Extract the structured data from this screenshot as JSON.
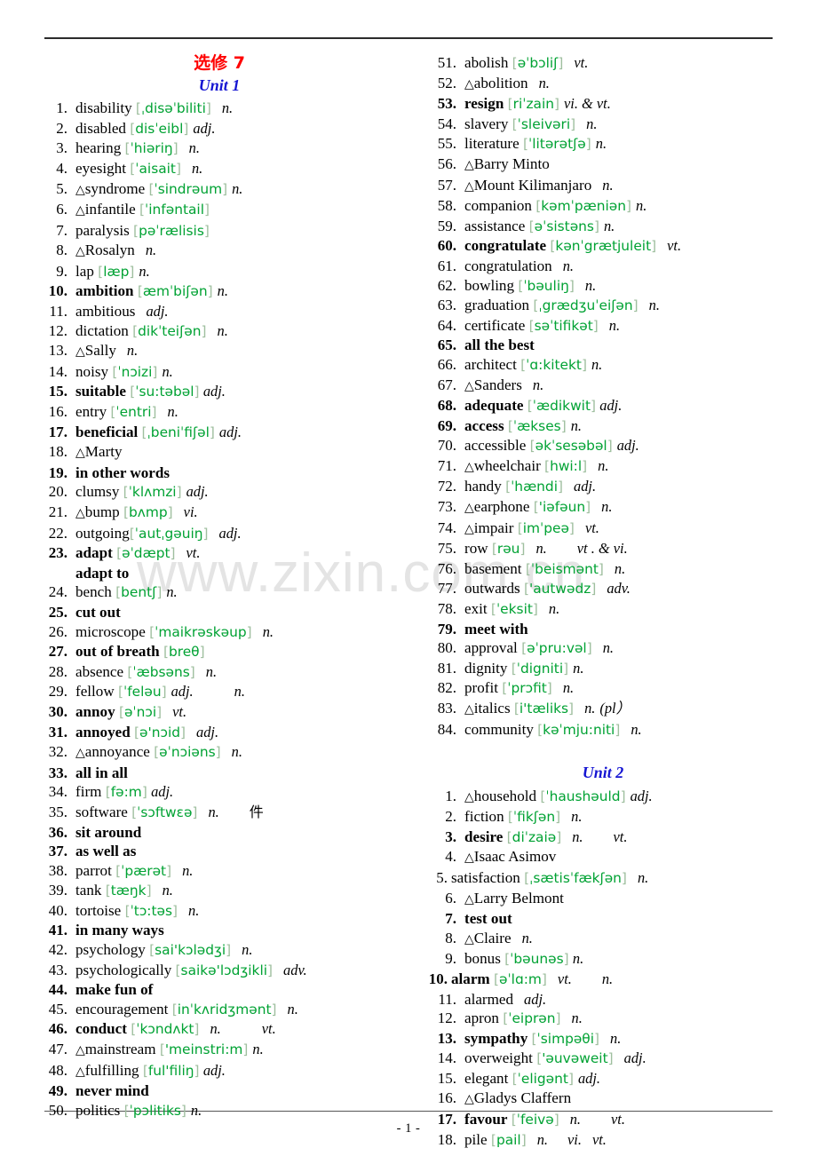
{
  "document": {
    "title_main": "选修 7",
    "watermark": "www.zixin.com.cn",
    "page_number": "- 1 -"
  },
  "left_column": {
    "unit_heading": "Unit 1",
    "entries": [
      {
        "n": "1.",
        "word": "disability",
        "ph": "[ˌdisəˈbiliti]",
        "pos": "n.",
        "bold": false,
        "tri": false,
        "gap": "sp2"
      },
      {
        "n": "2.",
        "word": "disabled",
        "ph": "[disˈeibl]",
        "pos": "adj.",
        "bold": false,
        "tri": false,
        "gap": "sp1"
      },
      {
        "n": "3.",
        "word": "hearing",
        "ph": "[ˈhiəriŋ]",
        "pos": "n.",
        "bold": false,
        "tri": false,
        "gap": "sp2"
      },
      {
        "n": "4.",
        "word": "eyesight",
        "ph": "[ˈaisait]",
        "pos": "n.",
        "bold": false,
        "tri": false,
        "gap": "sp2"
      },
      {
        "n": "5.",
        "word": "syndrome",
        "ph": "[ˈsindrəum]",
        "pos": "n.",
        "bold": false,
        "tri": true,
        "gap": "sp1"
      },
      {
        "n": "6.",
        "word": "infantile",
        "ph": "[ˈinfəntail]",
        "pos": "",
        "bold": false,
        "tri": true,
        "gap": "sp1"
      },
      {
        "n": "7.",
        "word": "paralysis",
        "ph": "[pəˈrælisis]",
        "pos": "",
        "bold": false,
        "tri": false,
        "gap": "sp1"
      },
      {
        "n": "8.",
        "word": "Rosalyn",
        "ph": "",
        "pos": "n.",
        "bold": false,
        "tri": true,
        "gap": "sp2"
      },
      {
        "n": "9.",
        "word": "lap",
        "ph": "[læp]",
        "pos": "n.",
        "bold": false,
        "tri": false,
        "gap": "sp1"
      },
      {
        "n": "10.",
        "word": "ambition",
        "ph": "[æmˈbiʃən]",
        "pos": "n.",
        "bold": true,
        "tri": false,
        "gap": "sp1"
      },
      {
        "n": "11.",
        "word": "ambitious",
        "ph": "",
        "pos": "adj.",
        "bold": false,
        "tri": false,
        "gap": "sp2"
      },
      {
        "n": "12.",
        "word": "dictation",
        "ph": "[dikˈteiʃən]",
        "pos": "n.",
        "bold": false,
        "tri": false,
        "gap": "sp2"
      },
      {
        "n": "13.",
        "word": "Sally",
        "ph": "",
        "pos": "n.",
        "bold": false,
        "tri": true,
        "gap": "sp2"
      },
      {
        "n": "14.",
        "word": "noisy",
        "ph": "[ˈnɔizi]",
        "pos": "n.",
        "bold": false,
        "tri": false,
        "gap": "sp1"
      },
      {
        "n": "15.",
        "word": "suitable",
        "ph": "[ˈsu:təbəl]",
        "pos": "adj.",
        "bold": true,
        "tri": false,
        "gap": ""
      },
      {
        "n": "16.",
        "word": "entry",
        "ph": "[ˈentri]",
        "pos": "n.",
        "bold": false,
        "tri": false,
        "gap": "sp2"
      },
      {
        "n": "17.",
        "word": "beneficial",
        "ph": "[ˌbeniˈfiʃəl]",
        "pos": "adj.",
        "bold": true,
        "tri": false,
        "gap": "sp1"
      },
      {
        "n": "18.",
        "word": "Marty",
        "ph": "",
        "pos": "",
        "bold": false,
        "tri": true,
        "gap": ""
      },
      {
        "n": "19.",
        "word": "in other words",
        "ph": "",
        "pos": "",
        "bold": true,
        "tri": false,
        "gap": ""
      },
      {
        "n": "20.",
        "word": "clumsy",
        "ph": "[ˈklʌmzi]",
        "pos": "adj.",
        "bold": false,
        "tri": false,
        "gap": "sp1"
      },
      {
        "n": "21.",
        "word": "bump",
        "ph": "[bʌmp]",
        "pos": "vi.",
        "bold": false,
        "tri": true,
        "gap": "sp2"
      },
      {
        "n": "22.",
        "word": "outgoing",
        "ph": "[ˈautˌgəuiŋ]",
        "pos": "adj.",
        "bold": false,
        "tri": false,
        "gap": "sp2",
        "nospace": true
      },
      {
        "n": "23.",
        "word": "adapt",
        "ph": "[əˈdæpt]",
        "pos": "vt.",
        "bold": true,
        "tri": false,
        "gap": "sp2"
      },
      {
        "n": "",
        "word": "adapt to",
        "ph": "",
        "pos": "",
        "bold": true,
        "tri": false,
        "gap": "",
        "cont": true
      },
      {
        "n": "24.",
        "word": "bench",
        "ph": "[bentʃ]",
        "pos": "n.",
        "bold": false,
        "tri": false,
        "gap": "sp1"
      },
      {
        "n": "25.",
        "word": "cut out",
        "ph": "",
        "pos": "",
        "bold": true,
        "tri": false,
        "gap": ""
      },
      {
        "n": "26.",
        "word": "microscope",
        "ph": "[ˈmaikrəskəup]",
        "pos": "n.",
        "bold": false,
        "tri": false,
        "gap": "sp2"
      },
      {
        "n": "27.",
        "word": "out of breath",
        "ph": "[breθ]",
        "pos": "",
        "bold": true,
        "tri": false,
        "gap": ""
      },
      {
        "n": "28.",
        "word": "absence",
        "ph": "[ˈæbsəns]",
        "pos": "n.",
        "bold": false,
        "tri": false,
        "gap": "sp2"
      },
      {
        "n": "29.",
        "word": "fellow",
        "ph": "[ˈfeləu]",
        "pos": "adj.",
        "pos2": "n.",
        "bold": false,
        "tri": false,
        "gap": "sp1",
        "gap2": "sp5"
      },
      {
        "n": "30.",
        "word": "annoy",
        "ph": "[əˈnɔi]",
        "pos": "vt.",
        "bold": true,
        "tri": false,
        "gap": "sp2"
      },
      {
        "n": "31.",
        "word": "annoyed",
        "ph": "[ə'nɔid]",
        "pos": "adj.",
        "bold": true,
        "tri": false,
        "gap": "sp2"
      },
      {
        "n": "32.",
        "word": "annoyance",
        "ph": "[əˈnɔiəns]",
        "pos": "n.",
        "bold": false,
        "tri": true,
        "gap": "sp2"
      },
      {
        "n": "33.",
        "word": "all in all",
        "ph": "",
        "pos": "",
        "bold": true,
        "tri": false,
        "gap": ""
      },
      {
        "n": "34.",
        "word": "firm",
        "ph": "[fə:m]",
        "pos": "adj.",
        "bold": false,
        "tri": false,
        "gap": ""
      },
      {
        "n": "35.",
        "word": "software",
        "ph": "[ˈsɔftwɛə]",
        "pos": "n.",
        "bold": false,
        "tri": false,
        "gap": "sp2",
        "cn": "件"
      },
      {
        "n": "36.",
        "word": "sit around",
        "ph": "",
        "pos": "",
        "bold": true,
        "tri": false,
        "gap": ""
      },
      {
        "n": "37.",
        "word": "as well as",
        "ph": "",
        "pos": "",
        "bold": true,
        "tri": false,
        "gap": ""
      },
      {
        "n": "38.",
        "word": "parrot",
        "ph": "[ˈpærət]",
        "pos": "n.",
        "bold": false,
        "tri": false,
        "gap": "sp2"
      },
      {
        "n": "39.",
        "word": "tank",
        "ph": "[tæŋk]",
        "pos": "n.",
        "bold": false,
        "tri": false,
        "gap": "sp2"
      },
      {
        "n": "40.",
        "word": "tortoise",
        "ph": "[ˈtɔ:təs]",
        "pos": "n.",
        "bold": false,
        "tri": false,
        "gap": "sp2"
      },
      {
        "n": "41.",
        "word": "in many ways",
        "ph": "",
        "pos": "",
        "bold": true,
        "tri": false,
        "gap": ""
      },
      {
        "n": "42.",
        "word": "psychology",
        "ph": "[sai'kɔlədʒi]",
        "pos": "n.",
        "bold": false,
        "tri": false,
        "gap": "sp2"
      },
      {
        "n": "43.",
        "word": "psychologically",
        "ph": "[saikə'lɔdʒikli]",
        "pos": "adv.",
        "bold": false,
        "tri": false,
        "gap": "sp2"
      },
      {
        "n": "44.",
        "word": "make fun of",
        "ph": "",
        "pos": "",
        "bold": true,
        "tri": false,
        "gap": ""
      },
      {
        "n": "45.",
        "word": "encouragement",
        "ph": "[inˈkʌridʒmənt]",
        "pos": "n.",
        "bold": false,
        "tri": false,
        "gap": "sp2"
      },
      {
        "n": "46.",
        "word": "conduct",
        "ph": "[ˈkɔndʌkt]",
        "pos": "n.",
        "pos2": "vt.",
        "bold": true,
        "tri": false,
        "gap": "sp2",
        "gap2": "sp5"
      },
      {
        "n": "47.",
        "word": "mainstream",
        "ph": "['meinstri:m]",
        "pos": "n.",
        "bold": false,
        "tri": true,
        "gap": "sp1"
      },
      {
        "n": "48.",
        "word": "fulfilling",
        "ph": "[ful'filiŋ]",
        "pos": "adj.",
        "bold": false,
        "tri": true,
        "gap": ""
      },
      {
        "n": "49.",
        "word": "never mind",
        "ph": "",
        "pos": "",
        "bold": true,
        "tri": false,
        "gap": ""
      },
      {
        "n": "50.",
        "word": "politics",
        "ph": "[ˈpɔlitiks]",
        "pos": "n.",
        "bold": false,
        "tri": false,
        "gap": "sp1"
      }
    ]
  },
  "right_column": {
    "unit1_entries": [
      {
        "n": "51.",
        "word": "abolish",
        "ph": "[əˈbɔliʃ]",
        "pos": "vt.",
        "bold": false,
        "tri": false,
        "gap": "sp2"
      },
      {
        "n": "52.",
        "word": "abolition",
        "ph": "",
        "pos": "n.",
        "bold": false,
        "tri": true,
        "gap": "sp2"
      },
      {
        "n": "53.",
        "word": "resign",
        "ph": "[riˈzain]",
        "pos": "vi. & vt.",
        "bold": true,
        "tri": false,
        "gap": "sp1"
      },
      {
        "n": "54.",
        "word": "slavery",
        "ph": "[ˈsleivəri]",
        "pos": "n.",
        "bold": false,
        "tri": false,
        "gap": "sp2"
      },
      {
        "n": "55.",
        "word": "literature",
        "ph": "[ˈlitərətʃə]",
        "pos": "n.",
        "bold": false,
        "tri": false,
        "gap": "sp1"
      },
      {
        "n": "56.",
        "word": "Barry Minto",
        "ph": "",
        "pos": "",
        "bold": false,
        "tri": true,
        "gap": ""
      },
      {
        "n": "57.",
        "word": "Mount Kilimanjaro",
        "ph": "",
        "pos": "n.",
        "bold": false,
        "tri": true,
        "gap": "sp2"
      },
      {
        "n": "58.",
        "word": "companion",
        "ph": "[kəmˈpæniən]",
        "pos": "n.",
        "bold": false,
        "tri": false,
        "gap": "sp1"
      },
      {
        "n": "59.",
        "word": "assistance",
        "ph": "[əˈsistəns]",
        "pos": "n.",
        "bold": false,
        "tri": false,
        "gap": "sp1"
      },
      {
        "n": "60.",
        "word": "congratulate",
        "ph": "[kənˈgrætjuleit]",
        "pos": "vt.",
        "bold": true,
        "tri": false,
        "gap": "sp2"
      },
      {
        "n": "61.",
        "word": "congratulation",
        "ph": "",
        "pos": "n.",
        "bold": false,
        "tri": false,
        "gap": "sp2"
      },
      {
        "n": "62.",
        "word": "bowling",
        "ph": "[ˈbəuliŋ]",
        "pos": "n.",
        "bold": false,
        "tri": false,
        "gap": "sp2"
      },
      {
        "n": "63.",
        "word": "graduation",
        "ph": "[ˌgrædʒuˈeiʃən]",
        "pos": "n.",
        "bold": false,
        "tri": false,
        "gap": "sp2"
      },
      {
        "n": "64.",
        "word": "certificate",
        "ph": "[səˈtifikət]",
        "pos": "n.",
        "bold": false,
        "tri": false,
        "gap": "sp2"
      },
      {
        "n": "65.",
        "word": "all the best",
        "ph": "",
        "pos": "",
        "bold": true,
        "tri": false,
        "gap": ""
      },
      {
        "n": "66.",
        "word": "architect",
        "ph": "[ˈɑ:kitekt]",
        "pos": "n.",
        "bold": false,
        "tri": false,
        "gap": "sp1"
      },
      {
        "n": "67.",
        "word": "Sanders",
        "ph": "",
        "pos": "n.",
        "bold": false,
        "tri": true,
        "gap": "sp2"
      },
      {
        "n": "68.",
        "word": "adequate",
        "ph": "[ˈædikwit]",
        "pos": "adj.",
        "bold": true,
        "tri": false,
        "gap": ""
      },
      {
        "n": "69.",
        "word": "access",
        "ph": "[ˈækses]",
        "pos": "n.",
        "bold": true,
        "tri": false,
        "gap": "sp1"
      },
      {
        "n": "70.",
        "word": "accessible",
        "ph": "[əkˈsesəbəl]",
        "pos": "adj.",
        "bold": false,
        "tri": false,
        "gap": "sp1"
      },
      {
        "n": "71.",
        "word": "wheelchair",
        "ph": "[hwi:l]",
        "pos": "n.",
        "bold": false,
        "tri": true,
        "gap": "sp2"
      },
      {
        "n": "72.",
        "word": "handy",
        "ph": "[ˈhændi]",
        "pos": "adj.",
        "bold": false,
        "tri": false,
        "gap": "sp2"
      },
      {
        "n": "73.",
        "word": "earphone",
        "ph": "['iəfəun]",
        "pos": "n.",
        "bold": false,
        "tri": true,
        "gap": "sp2"
      },
      {
        "n": "74.",
        "word": "impair",
        "ph": "[imˈpeə]",
        "pos": "vt.",
        "bold": false,
        "tri": true,
        "gap": "sp2"
      },
      {
        "n": "75.",
        "word": "row",
        "ph": "[rəu]",
        "pos": "n.",
        "pos2": "vt . & vi.",
        "bold": false,
        "tri": false,
        "gap": "sp2",
        "gap2": "sp4"
      },
      {
        "n": "76.",
        "word": "basement",
        "ph": "[ˈbeismənt]",
        "pos": "n.",
        "bold": false,
        "tri": false,
        "gap": "sp2"
      },
      {
        "n": "77.",
        "word": "outwards",
        "ph": "['autwədz]",
        "pos": "adv.",
        "bold": false,
        "tri": false,
        "gap": "sp2"
      },
      {
        "n": "78.",
        "word": "exit",
        "ph": "[ˈeksit]",
        "pos": "n.",
        "bold": false,
        "tri": false,
        "gap": "sp2"
      },
      {
        "n": "79.",
        "word": "meet with",
        "ph": "",
        "pos": "",
        "bold": true,
        "tri": false,
        "gap": ""
      },
      {
        "n": "80.",
        "word": "approval",
        "ph": "[əˈpru:vəl]",
        "pos": "n.",
        "bold": false,
        "tri": false,
        "gap": "sp2"
      },
      {
        "n": "81.",
        "word": "dignity",
        "ph": "[ˈdigniti]",
        "pos": "n.",
        "bold": false,
        "tri": false,
        "gap": "sp1"
      },
      {
        "n": "82.",
        "word": "profit",
        "ph": "[ˈprɔfit]",
        "pos": "n.",
        "bold": false,
        "tri": false,
        "gap": "sp2"
      },
      {
        "n": "83.",
        "word": "italics",
        "ph": "[i'tæliks]",
        "pos": "n.",
        "pos2": "(pl）",
        "bold": false,
        "tri": true,
        "gap": "sp2",
        "gap2": "sp1"
      },
      {
        "n": "84.",
        "word": "community",
        "ph": "[kəˈmju:niti]",
        "pos": "n.",
        "bold": false,
        "tri": false,
        "gap": "sp2"
      }
    ],
    "unit2_heading": "Unit 2",
    "unit2_entries": [
      {
        "n": "1.",
        "word": "household",
        "ph": "[ˈhaushəuld]",
        "pos": "adj.",
        "bold": false,
        "tri": true,
        "gap": "sp1"
      },
      {
        "n": "2.",
        "word": "fiction",
        "ph": "[ˈfikʃən]",
        "pos": "n.",
        "bold": false,
        "tri": false,
        "gap": "sp2"
      },
      {
        "n": "3.",
        "word": "desire",
        "ph": "[diˈzaiə]",
        "pos": "n.",
        "pos2": "vt.",
        "bold": true,
        "tri": false,
        "gap": "sp2",
        "gap2": "sp4"
      },
      {
        "n": "4.",
        "word": "Isaac Asimov",
        "ph": "",
        "pos": "",
        "bold": false,
        "tri": true,
        "gap": ""
      },
      {
        "n": "5.",
        "word": "satisfaction",
        "ph": "[ˌsætisˈfækʃən]",
        "pos": "n.",
        "bold": false,
        "tri": false,
        "gap": "sp2",
        "narrow": true
      },
      {
        "n": "6.",
        "word": "Larry Belmont",
        "ph": "",
        "pos": "",
        "bold": false,
        "tri": true,
        "gap": ""
      },
      {
        "n": "7.",
        "word": "test out",
        "ph": "",
        "pos": "",
        "bold": true,
        "tri": false,
        "gap": ""
      },
      {
        "n": "8.",
        "word": "Claire",
        "ph": "",
        "pos": "n.",
        "bold": false,
        "tri": true,
        "gap": "sp2"
      },
      {
        "n": "9.",
        "word": "bonus",
        "ph": "[ˈbəunəs]",
        "pos": "n.",
        "bold": false,
        "tri": false,
        "gap": ""
      },
      {
        "n": "10.",
        "word": "alarm",
        "ph": "[əˈlɑ:m]",
        "pos": "vt.",
        "pos2": "n.",
        "bold": true,
        "tri": false,
        "gap": "sp2",
        "gap2": "sp4",
        "narrow": true
      },
      {
        "n": "11.",
        "word": "alarmed",
        "ph": "",
        "pos": "adj.",
        "bold": false,
        "tri": false,
        "gap": "sp2"
      },
      {
        "n": "12.",
        "word": "apron",
        "ph": "[ˈeiprən]",
        "pos": "n.",
        "bold": false,
        "tri": false,
        "gap": "sp2"
      },
      {
        "n": "13.",
        "word": "sympathy",
        "ph": "[ˈsimpəθi]",
        "pos": "n.",
        "bold": true,
        "tri": false,
        "gap": "sp2"
      },
      {
        "n": "14.",
        "word": "overweight",
        "ph": "['əuvəweit]",
        "pos": "adj.",
        "bold": false,
        "tri": false,
        "gap": "sp2"
      },
      {
        "n": "15.",
        "word": "elegant",
        "ph": "[ˈeligənt]",
        "pos": "adj.",
        "bold": false,
        "tri": false,
        "gap": "sp1"
      },
      {
        "n": "16.",
        "word": "Gladys Claffern",
        "ph": "",
        "pos": "",
        "bold": false,
        "tri": true,
        "gap": ""
      },
      {
        "n": "17.",
        "word": "favour",
        "ph": "[ˈfeivə]",
        "pos": "n.",
        "pos2": "vt.",
        "bold": true,
        "tri": false,
        "gap": "sp2",
        "gap2": "sp4"
      },
      {
        "n": "18.",
        "word": "pile",
        "ph": "[pail]",
        "pos": "n.",
        "pos2": "vi.",
        "pos3": "vt.",
        "bold": false,
        "tri": false,
        "gap": "sp2",
        "gap2": "sp3",
        "gap3": "sp2"
      }
    ]
  },
  "colors": {
    "title_red": "#ff0000",
    "unit_blue": "#1414d2",
    "phonetic_green": "#00a233",
    "bracket_gray_green": "#9fbf9f",
    "watermark_gray": "#e4e4e4"
  }
}
